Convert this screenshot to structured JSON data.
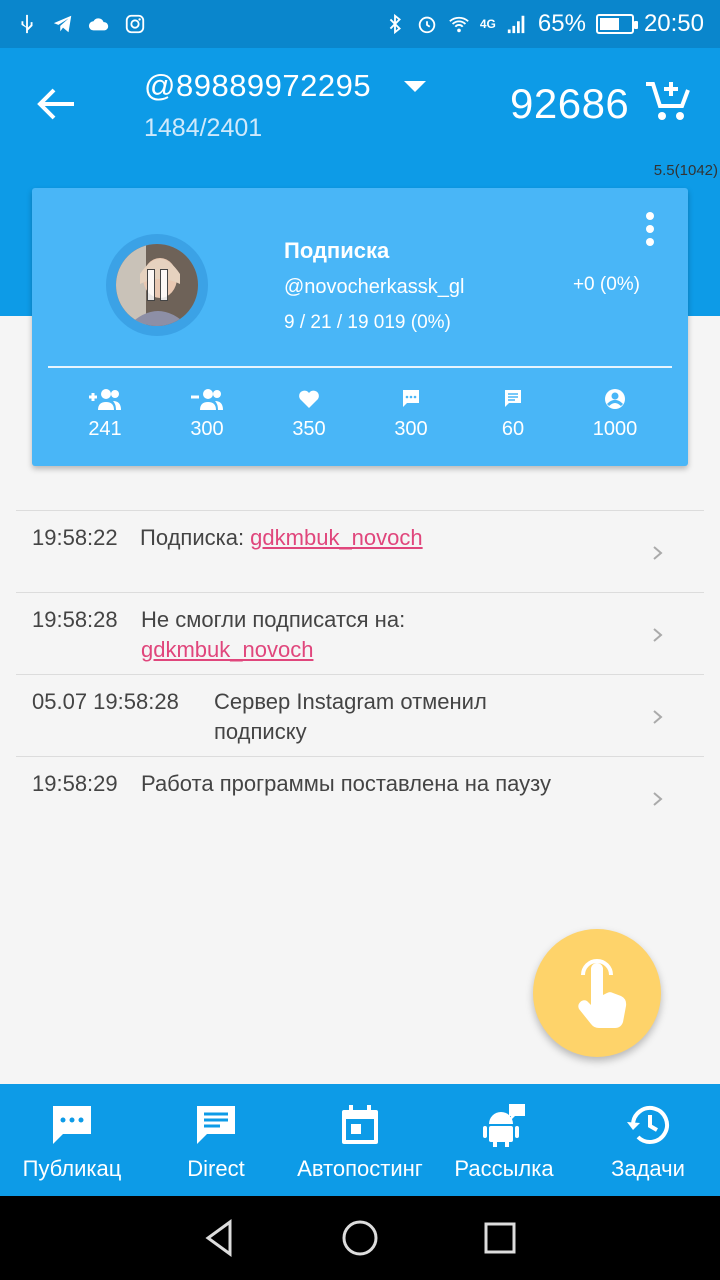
{
  "status_bar": {
    "battery": "65%",
    "battery_level": 0.65,
    "time": "20:50",
    "network": "4G",
    "left_icons": [
      "usb-icon",
      "telegram-icon",
      "cloud-icon",
      "instagram-icon"
    ]
  },
  "app_bar": {
    "account": "@89889972295",
    "progress": "1484/2401",
    "balance": "92686",
    "version": "5.5(1042)"
  },
  "card": {
    "title": "Подписка",
    "username": "@novocherkassk_gl",
    "stats": "9 / 21 / 19 019 (0%)",
    "delta": "+0 (0%)",
    "counters": [
      {
        "icon": "add-person-icon",
        "value": "241"
      },
      {
        "icon": "remove-person-icon",
        "value": "300"
      },
      {
        "icon": "heart-icon",
        "value": "350"
      },
      {
        "icon": "comment-icon",
        "value": "300"
      },
      {
        "icon": "message-icon",
        "value": "60"
      },
      {
        "icon": "profile-icon",
        "value": "1000"
      }
    ]
  },
  "log": [
    {
      "time": "19:58:22",
      "text": "Подписка: ",
      "link": "gdkmbuk_novoch"
    },
    {
      "time": "19:58:28",
      "text": "Не смогли подписатся на:",
      "link": "gdkmbuk_novoch"
    },
    {
      "time": "05.07 19:58:28",
      "text": "Сервер Instagram отменил подписку",
      "link": ""
    },
    {
      "time": "19:58:29",
      "text": "Работа программы поставлена на паузу",
      "link": ""
    }
  ],
  "bottom_nav": [
    {
      "icon": "chat-bubble-icon",
      "label": "Публикац"
    },
    {
      "icon": "message-icon",
      "label": "Direct"
    },
    {
      "icon": "calendar-icon",
      "label": "Автопостинг"
    },
    {
      "icon": "android-icon",
      "label": "Рассылка"
    },
    {
      "icon": "history-icon",
      "label": "Задачи"
    }
  ],
  "colors": {
    "primary": "#0d9be7",
    "card": "#49b6f7",
    "link": "#e0467c",
    "fab": "#fed36a"
  }
}
